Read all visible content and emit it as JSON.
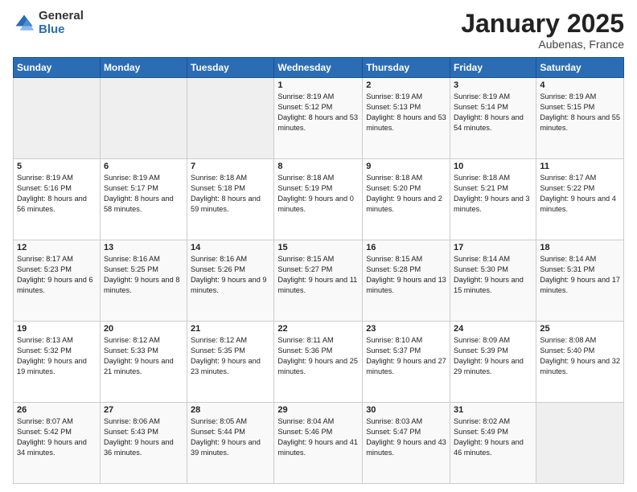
{
  "header": {
    "logo_general": "General",
    "logo_blue": "Blue",
    "month_title": "January 2025",
    "location": "Aubenas, France"
  },
  "days_of_week": [
    "Sunday",
    "Monday",
    "Tuesday",
    "Wednesday",
    "Thursday",
    "Friday",
    "Saturday"
  ],
  "weeks": [
    [
      {
        "day": "",
        "info": ""
      },
      {
        "day": "",
        "info": ""
      },
      {
        "day": "",
        "info": ""
      },
      {
        "day": "1",
        "info": "Sunrise: 8:19 AM\nSunset: 5:12 PM\nDaylight: 8 hours\nand 53 minutes."
      },
      {
        "day": "2",
        "info": "Sunrise: 8:19 AM\nSunset: 5:13 PM\nDaylight: 8 hours\nand 53 minutes."
      },
      {
        "day": "3",
        "info": "Sunrise: 8:19 AM\nSunset: 5:14 PM\nDaylight: 8 hours\nand 54 minutes."
      },
      {
        "day": "4",
        "info": "Sunrise: 8:19 AM\nSunset: 5:15 PM\nDaylight: 8 hours\nand 55 minutes."
      }
    ],
    [
      {
        "day": "5",
        "info": "Sunrise: 8:19 AM\nSunset: 5:16 PM\nDaylight: 8 hours\nand 56 minutes."
      },
      {
        "day": "6",
        "info": "Sunrise: 8:19 AM\nSunset: 5:17 PM\nDaylight: 8 hours\nand 58 minutes."
      },
      {
        "day": "7",
        "info": "Sunrise: 8:18 AM\nSunset: 5:18 PM\nDaylight: 8 hours\nand 59 minutes."
      },
      {
        "day": "8",
        "info": "Sunrise: 8:18 AM\nSunset: 5:19 PM\nDaylight: 9 hours\nand 0 minutes."
      },
      {
        "day": "9",
        "info": "Sunrise: 8:18 AM\nSunset: 5:20 PM\nDaylight: 9 hours\nand 2 minutes."
      },
      {
        "day": "10",
        "info": "Sunrise: 8:18 AM\nSunset: 5:21 PM\nDaylight: 9 hours\nand 3 minutes."
      },
      {
        "day": "11",
        "info": "Sunrise: 8:17 AM\nSunset: 5:22 PM\nDaylight: 9 hours\nand 4 minutes."
      }
    ],
    [
      {
        "day": "12",
        "info": "Sunrise: 8:17 AM\nSunset: 5:23 PM\nDaylight: 9 hours\nand 6 minutes."
      },
      {
        "day": "13",
        "info": "Sunrise: 8:16 AM\nSunset: 5:25 PM\nDaylight: 9 hours\nand 8 minutes."
      },
      {
        "day": "14",
        "info": "Sunrise: 8:16 AM\nSunset: 5:26 PM\nDaylight: 9 hours\nand 9 minutes."
      },
      {
        "day": "15",
        "info": "Sunrise: 8:15 AM\nSunset: 5:27 PM\nDaylight: 9 hours\nand 11 minutes."
      },
      {
        "day": "16",
        "info": "Sunrise: 8:15 AM\nSunset: 5:28 PM\nDaylight: 9 hours\nand 13 minutes."
      },
      {
        "day": "17",
        "info": "Sunrise: 8:14 AM\nSunset: 5:30 PM\nDaylight: 9 hours\nand 15 minutes."
      },
      {
        "day": "18",
        "info": "Sunrise: 8:14 AM\nSunset: 5:31 PM\nDaylight: 9 hours\nand 17 minutes."
      }
    ],
    [
      {
        "day": "19",
        "info": "Sunrise: 8:13 AM\nSunset: 5:32 PM\nDaylight: 9 hours\nand 19 minutes."
      },
      {
        "day": "20",
        "info": "Sunrise: 8:12 AM\nSunset: 5:33 PM\nDaylight: 9 hours\nand 21 minutes."
      },
      {
        "day": "21",
        "info": "Sunrise: 8:12 AM\nSunset: 5:35 PM\nDaylight: 9 hours\nand 23 minutes."
      },
      {
        "day": "22",
        "info": "Sunrise: 8:11 AM\nSunset: 5:36 PM\nDaylight: 9 hours\nand 25 minutes."
      },
      {
        "day": "23",
        "info": "Sunrise: 8:10 AM\nSunset: 5:37 PM\nDaylight: 9 hours\nand 27 minutes."
      },
      {
        "day": "24",
        "info": "Sunrise: 8:09 AM\nSunset: 5:39 PM\nDaylight: 9 hours\nand 29 minutes."
      },
      {
        "day": "25",
        "info": "Sunrise: 8:08 AM\nSunset: 5:40 PM\nDaylight: 9 hours\nand 32 minutes."
      }
    ],
    [
      {
        "day": "26",
        "info": "Sunrise: 8:07 AM\nSunset: 5:42 PM\nDaylight: 9 hours\nand 34 minutes."
      },
      {
        "day": "27",
        "info": "Sunrise: 8:06 AM\nSunset: 5:43 PM\nDaylight: 9 hours\nand 36 minutes."
      },
      {
        "day": "28",
        "info": "Sunrise: 8:05 AM\nSunset: 5:44 PM\nDaylight: 9 hours\nand 39 minutes."
      },
      {
        "day": "29",
        "info": "Sunrise: 8:04 AM\nSunset: 5:46 PM\nDaylight: 9 hours\nand 41 minutes."
      },
      {
        "day": "30",
        "info": "Sunrise: 8:03 AM\nSunset: 5:47 PM\nDaylight: 9 hours\nand 43 minutes."
      },
      {
        "day": "31",
        "info": "Sunrise: 8:02 AM\nSunset: 5:49 PM\nDaylight: 9 hours\nand 46 minutes."
      },
      {
        "day": "",
        "info": ""
      }
    ]
  ]
}
